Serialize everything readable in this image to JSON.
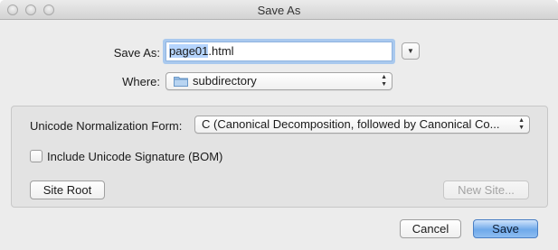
{
  "window": {
    "title": "Save As"
  },
  "save_as": {
    "label": "Save As:",
    "filename_selected": "page01",
    "filename_rest": ".html"
  },
  "where": {
    "label": "Where:",
    "value": "subdirectory"
  },
  "normalization": {
    "label": "Unicode Normalization Form:",
    "value": "C (Canonical Decomposition, followed by Canonical Co..."
  },
  "bom": {
    "label": "Include Unicode Signature (BOM)",
    "checked": false
  },
  "buttons": {
    "site_root": "Site Root",
    "new_site": "New Site...",
    "cancel": "Cancel",
    "save": "Save"
  },
  "colors": {
    "accent": "#6fa9ea",
    "selection": "#b5d4fd",
    "focus_ring": "#a9c9ee"
  },
  "icons": {
    "close": "close-traffic-light-icon",
    "minimize": "minimize-traffic-light-icon",
    "zoom": "zoom-traffic-light-icon",
    "expand": "disclosure-triangle-icon",
    "folder": "folder-icon",
    "popup_arrows": "up-down-arrows-icon"
  }
}
